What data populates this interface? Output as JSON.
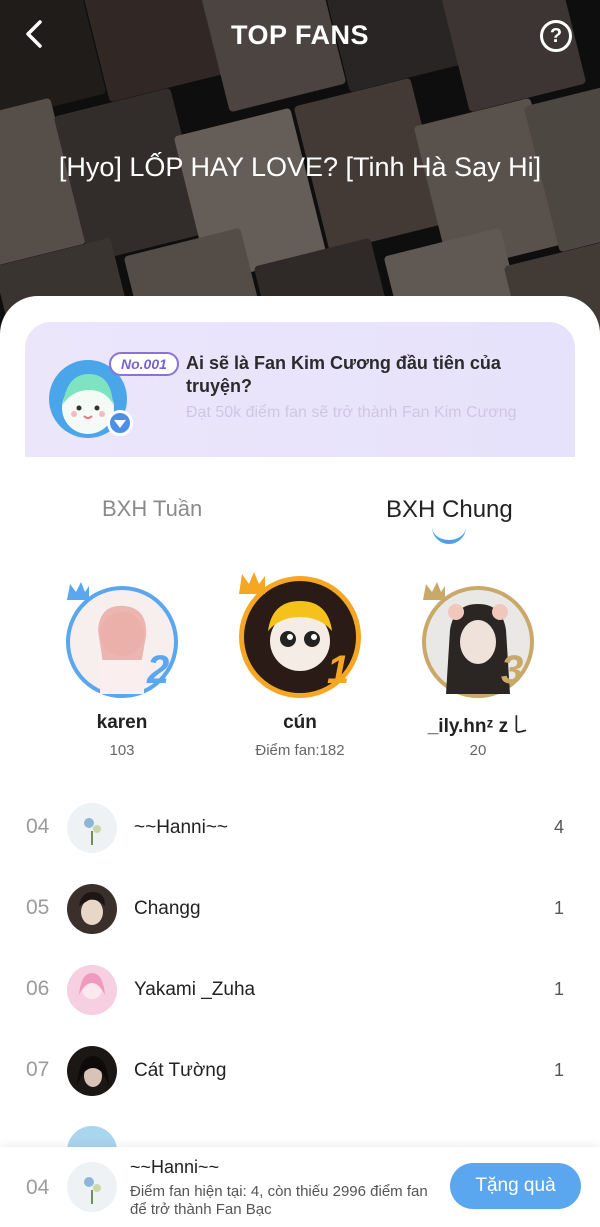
{
  "header": {
    "title": "TOP FANS",
    "help_symbol": "?",
    "comic_title": "[Hyo] LỐP HAY LOVE? [Tinh Hà Say Hi]"
  },
  "promo": {
    "tag": "No.001",
    "title": "Ai sẽ là Fan Kim Cương đầu tiên của truyện?",
    "subtitle": "Đạt 50k điểm fan sẽ trở thành Fan Kim Cương"
  },
  "tabs": [
    {
      "label": "BXH Tuần",
      "active": false
    },
    {
      "label": "BXH Chung",
      "active": true
    }
  ],
  "podium": [
    {
      "rank": "2",
      "name": "karen",
      "score": "103",
      "ring_color": "#5aa7ef"
    },
    {
      "rank": "1",
      "name": "cún",
      "score": "Điểm fan:182",
      "ring_color": "#f5a623"
    },
    {
      "rank": "3",
      "name": "_ily.hnᶻ z ꒒",
      "score": "20",
      "ring_color": "#c9a96a"
    }
  ],
  "ranking": [
    {
      "rank": "04",
      "name": "~~Hanni~~",
      "score": "4"
    },
    {
      "rank": "05",
      "name": "Changg",
      "score": "1"
    },
    {
      "rank": "06",
      "name": "Yakami _Zuha",
      "score": "1"
    },
    {
      "rank": "07",
      "name": "Cát Tường",
      "score": "1"
    }
  ],
  "me": {
    "rank": "04",
    "name": "~~Hanni~~",
    "description": "Điểm fan hiện tại: 4, còn thiếu 2996 điểm fan để trở thành Fan Bạc",
    "gift_button": "Tặng quà"
  },
  "colors": {
    "accent": "#5aa7ef",
    "promo_bg": "#ece6fb",
    "gold": "#f5a623"
  }
}
